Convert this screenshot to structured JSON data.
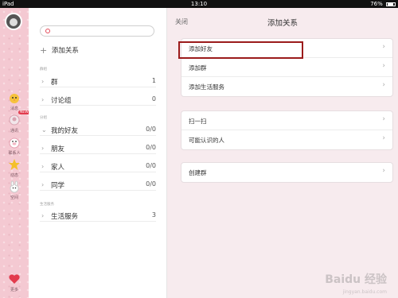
{
  "status_bar": {
    "device": "iPad",
    "time": "13:10",
    "battery": "76%"
  },
  "rail": {
    "items": [
      {
        "label": "消息",
        "icon": "chick-icon",
        "badge": ""
      },
      {
        "label": "通讯",
        "icon": "contacts-icon",
        "badge": "NEW"
      },
      {
        "label": "联系人",
        "icon": "pig-icon",
        "badge": ""
      },
      {
        "label": "动态",
        "icon": "star-icon",
        "badge": ""
      },
      {
        "label": "空间",
        "icon": "bunny-icon",
        "badge": ""
      }
    ],
    "bottom_label": "更多"
  },
  "list_panel": {
    "search_placeholder": "",
    "add_contact": "添加关系",
    "sections": [
      {
        "title": "群组",
        "rows": [
          {
            "label": "群",
            "count": "1"
          },
          {
            "label": "讨论组",
            "count": "0"
          }
        ]
      },
      {
        "title": "分组",
        "rows": [
          {
            "label": "我的好友",
            "count": "0/0",
            "expanded": true
          },
          {
            "label": "朋友",
            "count": "0/0"
          },
          {
            "label": "家人",
            "count": "0/0"
          },
          {
            "label": "同学",
            "count": "0/0"
          }
        ]
      },
      {
        "title": "生活服务",
        "rows": [
          {
            "label": "生活服务",
            "count": "3"
          }
        ]
      }
    ]
  },
  "right_panel": {
    "close_label": "关闭",
    "title": "添加关系",
    "groups": [
      [
        "添加好友",
        "添加群",
        "添加生活服务"
      ],
      [
        "扫一扫",
        "可能认识的人"
      ],
      [
        "创建群"
      ]
    ]
  },
  "watermark": {
    "text": "Baidu 经验",
    "sub": "jingyan.baidu.com"
  },
  "colors": {
    "rail_pink": "#f4c9d2",
    "panel_bg": "#f7ebee",
    "highlight": "#9b1b1b"
  }
}
